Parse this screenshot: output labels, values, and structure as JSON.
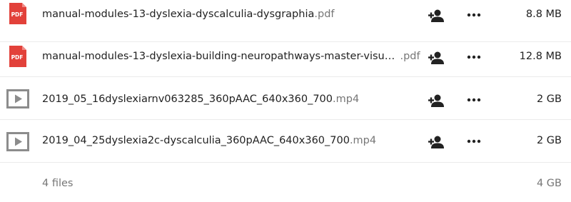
{
  "files": [
    {
      "icon": "pdf-icon",
      "name": "manual-modules-13-dyslexia-dyscalculia-dysgraphia",
      "ext": ".pdf",
      "size": "8.8 MB"
    },
    {
      "icon": "pdf-icon",
      "name": "manual-modules-13-dyslexia-building-neuropathways-master-visu…",
      "ext": ".pdf",
      "size": "12.8 MB"
    },
    {
      "icon": "video-icon",
      "name": "2019_05_16dyslexiarnv063285_360pAAC_640x360_700",
      "ext": ".mp4",
      "size": "2 GB"
    },
    {
      "icon": "video-icon",
      "name": "2019_04_25dyslexia2c-dyscalculia_360pAAC_640x360_700",
      "ext": ".mp4",
      "size": "2 GB"
    }
  ],
  "summary": {
    "count": "4 files",
    "total_size": "4 GB"
  },
  "icons": {
    "pdf_label": "PDF"
  },
  "colors": {
    "pdf_red": "#e2413a",
    "video_gray": "#8c8c8c",
    "action_dark": "#222222"
  }
}
